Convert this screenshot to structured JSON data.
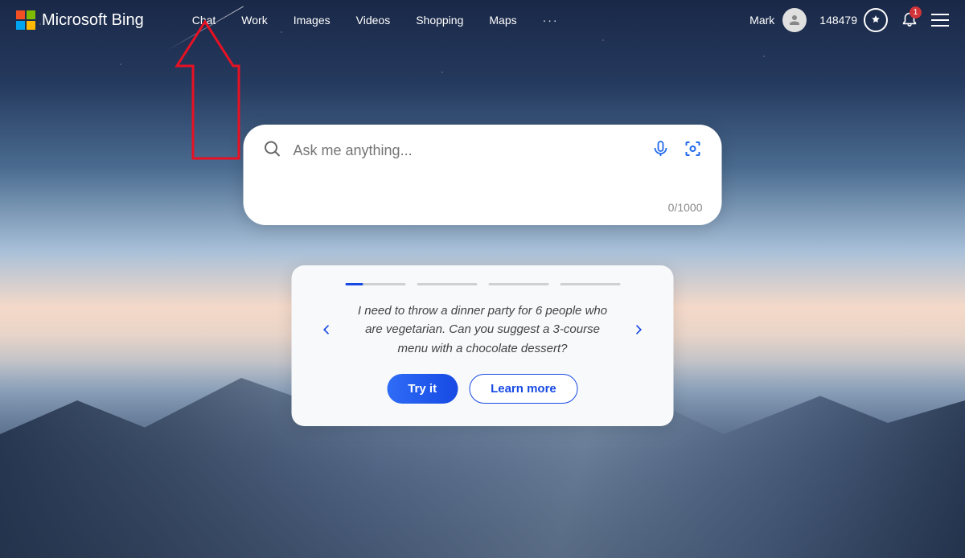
{
  "logo": {
    "text": "Microsoft Bing"
  },
  "nav": {
    "items": [
      "Chat",
      "Work",
      "Images",
      "Videos",
      "Shopping",
      "Maps"
    ],
    "more": "···"
  },
  "user": {
    "name": "Mark",
    "points": "148479",
    "notif_count": "1"
  },
  "search": {
    "placeholder": "Ask me anything...",
    "counter": "0/1000"
  },
  "card": {
    "prompt": "I need to throw a dinner party for 6 people who are vegetarian. Can you suggest a 3-course menu with a chocolate dessert?",
    "try_label": "Try it",
    "learn_label": "Learn more"
  }
}
